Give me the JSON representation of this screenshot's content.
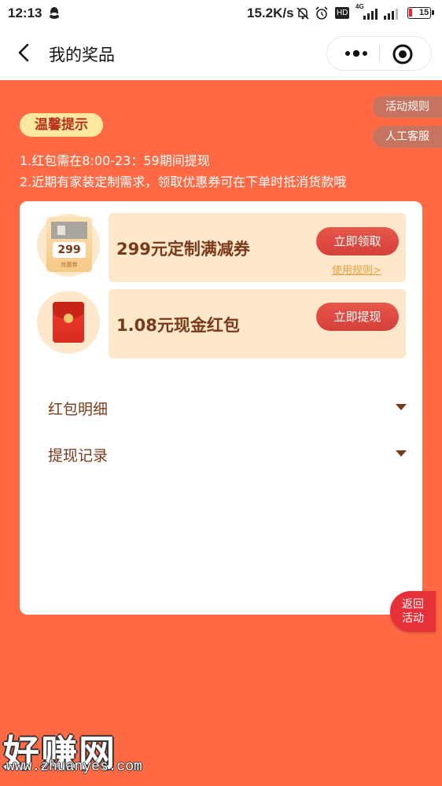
{
  "status_bar": {
    "time": "12:13",
    "net_speed": "15.2K/s",
    "hd_label": "HD",
    "network_label": "4G",
    "battery": "15"
  },
  "nav": {
    "title": "我的奖品"
  },
  "side_tabs": {
    "rules": "活动规则",
    "service": "人工客服"
  },
  "tips": {
    "badge": "温馨提示",
    "line1": "1.红包需在8:00-23：59期间提现",
    "line2": "2.近期有家装定制需求，领取优惠券可在下单时抵消货款哦"
  },
  "prizes": [
    {
      "name": "299元定制满减券",
      "button": "立即领取",
      "link": "使用规则>",
      "image_value": "299",
      "image_sub": "优惠券"
    },
    {
      "name": "1.08元现金红包",
      "button": "立即提现"
    }
  ],
  "details": {
    "redpacket_detail": "红包明细",
    "withdraw_record": "提现记录"
  },
  "return_button": {
    "line1": "返回",
    "line2": "活动"
  },
  "watermark": {
    "big": "好赚网",
    "small": "www.zhuanyes.com"
  },
  "colors": {
    "background": "#ff6a45",
    "card": "#ffffff",
    "prize_bg": "#fde8cc",
    "accent_red": "#e63138",
    "text_brown": "#7a3a1a"
  }
}
